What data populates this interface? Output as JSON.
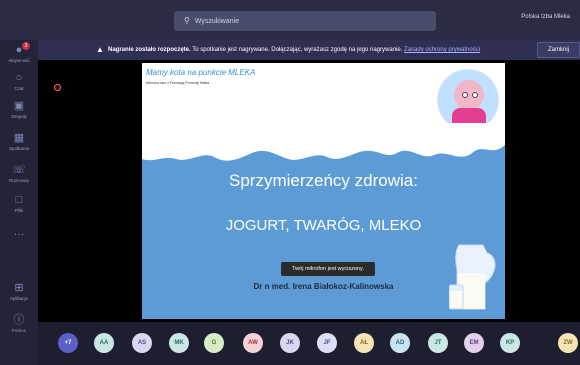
{
  "search": {
    "placeholder": "Wyszukiwanie"
  },
  "user": {
    "name": "Polska Izba Mleka"
  },
  "rail": {
    "badge": "3",
    "items": [
      {
        "label": "Aktywność",
        "icon": "bell-icon"
      },
      {
        "label": "Czat",
        "icon": "chat-icon"
      },
      {
        "label": "Zespoły",
        "icon": "teams-icon"
      },
      {
        "label": "Spotkania",
        "icon": "calendar-icon"
      },
      {
        "label": "Rozmowy",
        "icon": "phone-icon"
      },
      {
        "label": "Pliki",
        "icon": "file-icon"
      },
      {
        "label": "…",
        "icon": "more-icon"
      },
      {
        "label": "Aplikacje",
        "icon": "apps-icon"
      },
      {
        "label": "Pomoc",
        "icon": "help-icon"
      }
    ]
  },
  "banner": {
    "bold": "Nagranie zostało rozpoczęte.",
    "text": " To spotkanie jest nagrywane. Dołączając, wyrażasz zgodę na jego nagrywanie. ",
    "link": "Zasady ochrony prywatności",
    "button": "Zamknij"
  },
  "slide": {
    "title": "Mamy kota na punkcie MLEKA",
    "subtitle": "Mleczna sieć z Fundacją Promocji Mleka",
    "heading": "Sprzymierzeńcy zdrowia:",
    "subheading": "JOGURT, TWARÓG, MLEKO",
    "author": "Dr n med. Irena Białokoz-Kalinowska"
  },
  "toast": "Twój mikrofon jest wyciszony.",
  "participants": {
    "more": "+7",
    "list": [
      {
        "initials": "AA",
        "bg": "#c9e7e5",
        "fg": "#2f6b66"
      },
      {
        "initials": "AS",
        "bg": "#d7d9ee",
        "fg": "#4a4f8c"
      },
      {
        "initials": "MK",
        "bg": "#c9e7e5",
        "fg": "#2f6b66"
      },
      {
        "initials": "G",
        "bg": "#d6ecc7",
        "fg": "#4b7a2c"
      },
      {
        "initials": "AW",
        "bg": "#f3d1d6",
        "fg": "#a03040"
      },
      {
        "initials": "JK",
        "bg": "#d7d9ee",
        "fg": "#4a4f8c"
      },
      {
        "initials": "JF",
        "bg": "#dde0f2",
        "fg": "#4a4f8c"
      },
      {
        "initials": "AŁ",
        "bg": "#f6e4b8",
        "fg": "#8a6a12"
      },
      {
        "initials": "AD",
        "bg": "#c9e3f3",
        "fg": "#2a6a95"
      },
      {
        "initials": "JT",
        "bg": "#c9e7e5",
        "fg": "#2f6b66"
      },
      {
        "initials": "EM",
        "bg": "#e1d2ea",
        "fg": "#6b3d86"
      },
      {
        "initials": "KP",
        "bg": "#c9e7e5",
        "fg": "#2f6b66"
      },
      {
        "initials": "ZW",
        "bg": "#f6e4b8",
        "fg": "#8a6a12"
      }
    ]
  }
}
